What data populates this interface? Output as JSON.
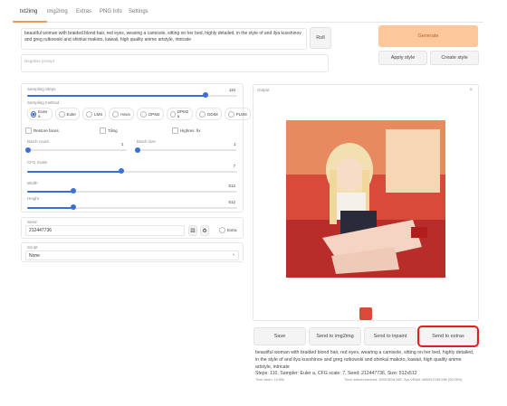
{
  "tabs": [
    {
      "label": "txt2img",
      "active": true
    },
    {
      "label": "img2img"
    },
    {
      "label": "Extras"
    },
    {
      "label": "PNG Info"
    },
    {
      "label": "Settings"
    }
  ],
  "prompt": {
    "value": "beautiful woman with braided blond hair, red eyes, wearing a camisole, sitting on her bed, highly detailed, in the style of and ilya kuvshinov and greg rutkowski and shinkai makoto, kawaii, high quality anime artstyle, intricate"
  },
  "negative_prompt": {
    "placeholder": "Negative prompt"
  },
  "roll_label": "Roll",
  "generate_label": "Generate",
  "apply_style_label": "Apply style",
  "create_style_label": "Create style",
  "sampling_steps": {
    "label": "Sampling Steps",
    "value": "110",
    "fraction": 0.85
  },
  "sampling_method": {
    "label": "Sampling method",
    "options": [
      "Euler a",
      "Euler",
      "LMS",
      "Heun",
      "DPM2",
      "DPM2 a",
      "DDIM",
      "PLMS"
    ],
    "selected": "Euler a"
  },
  "checkboxes": {
    "restore_faces": "Restore faces",
    "tiling": "Tiling",
    "highres_fix": "Highres. fix"
  },
  "batch_count": {
    "label": "Batch count",
    "value": "1",
    "fraction": 0.0
  },
  "batch_size": {
    "label": "Batch size",
    "value": "1",
    "fraction": 0.0
  },
  "cfg_scale": {
    "label": "CFG Scale",
    "value": "7",
    "fraction": 0.45
  },
  "width": {
    "label": "Width",
    "value": "512",
    "fraction": 0.22
  },
  "height": {
    "label": "Height",
    "value": "512",
    "fraction": 0.22
  },
  "seed": {
    "label": "Seed",
    "value": "212447736"
  },
  "extra_label": "Extra",
  "script": {
    "label": "Script",
    "value": "None"
  },
  "output": {
    "label": "Output"
  },
  "action_buttons": {
    "save": "Save",
    "send_img2img": "Send to img2img",
    "send_inpaint": "Send to inpaint",
    "send_extras": "Send to extras"
  },
  "info": {
    "prompt_text": "beautiful woman with braided blond hair, red eyes, wearing a camisole, sitting on her bed, highly detailed, in the style of and ilya kuvshinov and greg rutkowski and shinkai makoto, kawaii, high quality anime artstyle, intricate",
    "params": "Steps: 110, Sampler: Euler a, CFG scale: 7, Seed: 212447736, Size: 512x512",
    "time_taken": "Time taken: 19.69s",
    "vram": "Torch active/reserved: 3265/3618 MiB, Sys VRAM: 6889/12288 MiB (56.06%)"
  },
  "colors": {
    "accent": "#f09a5a",
    "slider": "#3b6fd8",
    "generate_bg": "#fcc79a",
    "highlight": "#e02020"
  }
}
